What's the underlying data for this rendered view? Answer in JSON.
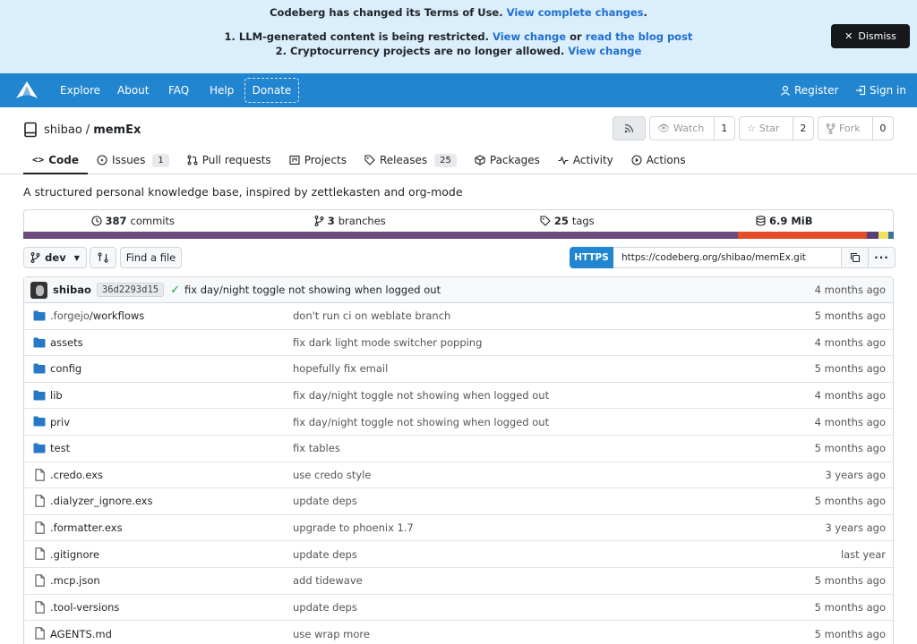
{
  "banner": {
    "line1_text": "Codeberg has changed its Terms of Use.",
    "line1_link": "View complete changes",
    "line1_end": ".",
    "item1_text": "1. LLM-generated content is being restricted.",
    "item1_link1": "View change",
    "item1_or": "or",
    "item1_link2": "read the blog post",
    "item2_text": "2. Cryptocurrency projects are no longer allowed.",
    "item2_link": "View change",
    "dismiss_label": "Dismiss"
  },
  "nav": {
    "explore": "Explore",
    "about": "About",
    "faq": "FAQ",
    "help": "Help",
    "donate": "Donate",
    "register": "Register",
    "signin": "Sign in"
  },
  "repo": {
    "owner": "shibao",
    "separator": "/",
    "name": "memEx",
    "watch_label": "Watch",
    "watch_count": "1",
    "star_label": "Star",
    "star_count": "2",
    "fork_label": "Fork",
    "fork_count": "0",
    "description": "A structured personal knowledge base, inspired by zettlekasten and org-mode"
  },
  "tabs": [
    {
      "label": "Code"
    },
    {
      "label": "Issues",
      "badge": "1"
    },
    {
      "label": "Pull requests"
    },
    {
      "label": "Projects"
    },
    {
      "label": "Releases",
      "badge": "25"
    },
    {
      "label": "Packages"
    },
    {
      "label": "Activity"
    },
    {
      "label": "Actions"
    }
  ],
  "stats": {
    "commits_num": "387",
    "commits_label": "commits",
    "branches_num": "3",
    "branches_label": "branches",
    "tags_num": "25",
    "tags_label": "tags",
    "size": "6.9 MiB"
  },
  "language_colors": [
    "#6e4a7e",
    "#e34c26",
    "#563d7c",
    "#f1e05a",
    "#3572a5"
  ],
  "toolbar": {
    "branch": "dev",
    "find_file": "Find a file",
    "https": "HTTPS",
    "clone_url": "https://codeberg.org/shibao/memEx.git"
  },
  "latest_commit": {
    "author": "shibao",
    "sha": "36d2293d15",
    "message": "fix day/night toggle not showing when logged out",
    "age": "4 months ago"
  },
  "files": [
    {
      "type": "dir",
      "prefix": ".forgejo",
      "name": "/workflows",
      "message": "don't run ci on weblate branch",
      "age": "5 months ago"
    },
    {
      "type": "dir",
      "prefix": "",
      "name": "assets",
      "message": "fix dark light mode switcher popping",
      "age": "4 months ago"
    },
    {
      "type": "dir",
      "prefix": "",
      "name": "config",
      "message": "hopefully fix email",
      "age": "5 months ago"
    },
    {
      "type": "dir",
      "prefix": "",
      "name": "lib",
      "message": "fix day/night toggle not showing when logged out",
      "age": "4 months ago"
    },
    {
      "type": "dir",
      "prefix": "",
      "name": "priv",
      "message": "fix day/night toggle not showing when logged out",
      "age": "4 months ago"
    },
    {
      "type": "dir",
      "prefix": "",
      "name": "test",
      "message": "fix tables",
      "age": "5 months ago"
    },
    {
      "type": "file",
      "prefix": "",
      "name": ".credo.exs",
      "message": "use credo style",
      "age": "3 years ago"
    },
    {
      "type": "file",
      "prefix": "",
      "name": ".dialyzer_ignore.exs",
      "message": "update deps",
      "age": "5 months ago"
    },
    {
      "type": "file",
      "prefix": "",
      "name": ".formatter.exs",
      "message": "upgrade to phoenix 1.7",
      "age": "3 years ago"
    },
    {
      "type": "file",
      "prefix": "",
      "name": ".gitignore",
      "message": "update deps",
      "age": "last year"
    },
    {
      "type": "file",
      "prefix": "",
      "name": ".mcp.json",
      "message": "add tidewave",
      "age": "5 months ago"
    },
    {
      "type": "file",
      "prefix": "",
      "name": ".tool-versions",
      "message": "update deps",
      "age": "5 months ago"
    },
    {
      "type": "file",
      "prefix": "",
      "name": "AGENTS.md",
      "message": "use wrap more",
      "age": "5 months ago"
    }
  ]
}
